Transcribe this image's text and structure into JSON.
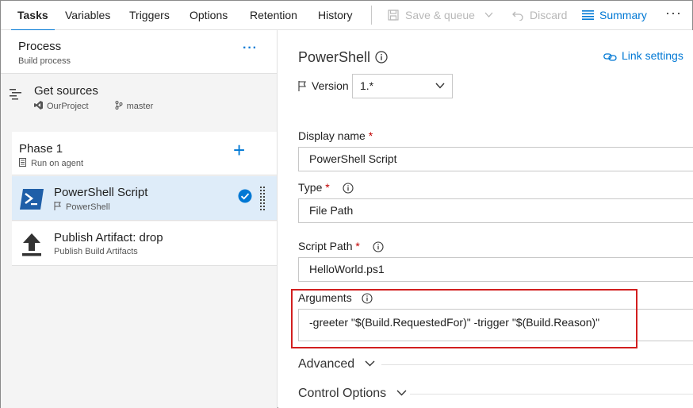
{
  "tabs": [
    "Tasks",
    "Variables",
    "Triggers",
    "Options",
    "Retention",
    "History"
  ],
  "toolbar": {
    "save_queue": "Save & queue",
    "discard": "Discard",
    "summary": "Summary",
    "more": "···"
  },
  "process": {
    "title": "Process",
    "subtitle": "Build process",
    "more": "···"
  },
  "get_sources": {
    "title": "Get sources",
    "project": "OurProject",
    "branch": "master"
  },
  "phase": {
    "title": "Phase 1",
    "subtitle": "Run on agent",
    "add": "+"
  },
  "tasks": [
    {
      "title": "PowerShell Script",
      "subtitle": "PowerShell",
      "selected": true
    },
    {
      "title": "Publish Artifact: drop",
      "subtitle": "Publish Build Artifacts",
      "selected": false
    }
  ],
  "detail": {
    "title": "PowerShell",
    "link_settings": "Link settings",
    "version_label": "Version",
    "version_value": "1.*",
    "display_name_label": "Display name",
    "display_name_value": "PowerShell Script",
    "type_label": "Type",
    "type_value": "File Path",
    "script_path_label": "Script Path",
    "script_path_value": "HelloWorld.ps1",
    "arguments_label": "Arguments",
    "arguments_value": "-greeter \"$(Build.RequestedFor)\" -trigger \"$(Build.Reason)\"",
    "required_mark": "*",
    "advanced": "Advanced",
    "control_options": "Control Options"
  },
  "colors": {
    "accent": "#0078d4",
    "selected_bg": "#deecf9",
    "highlight": "#d21f1f",
    "required": "#c00000"
  }
}
